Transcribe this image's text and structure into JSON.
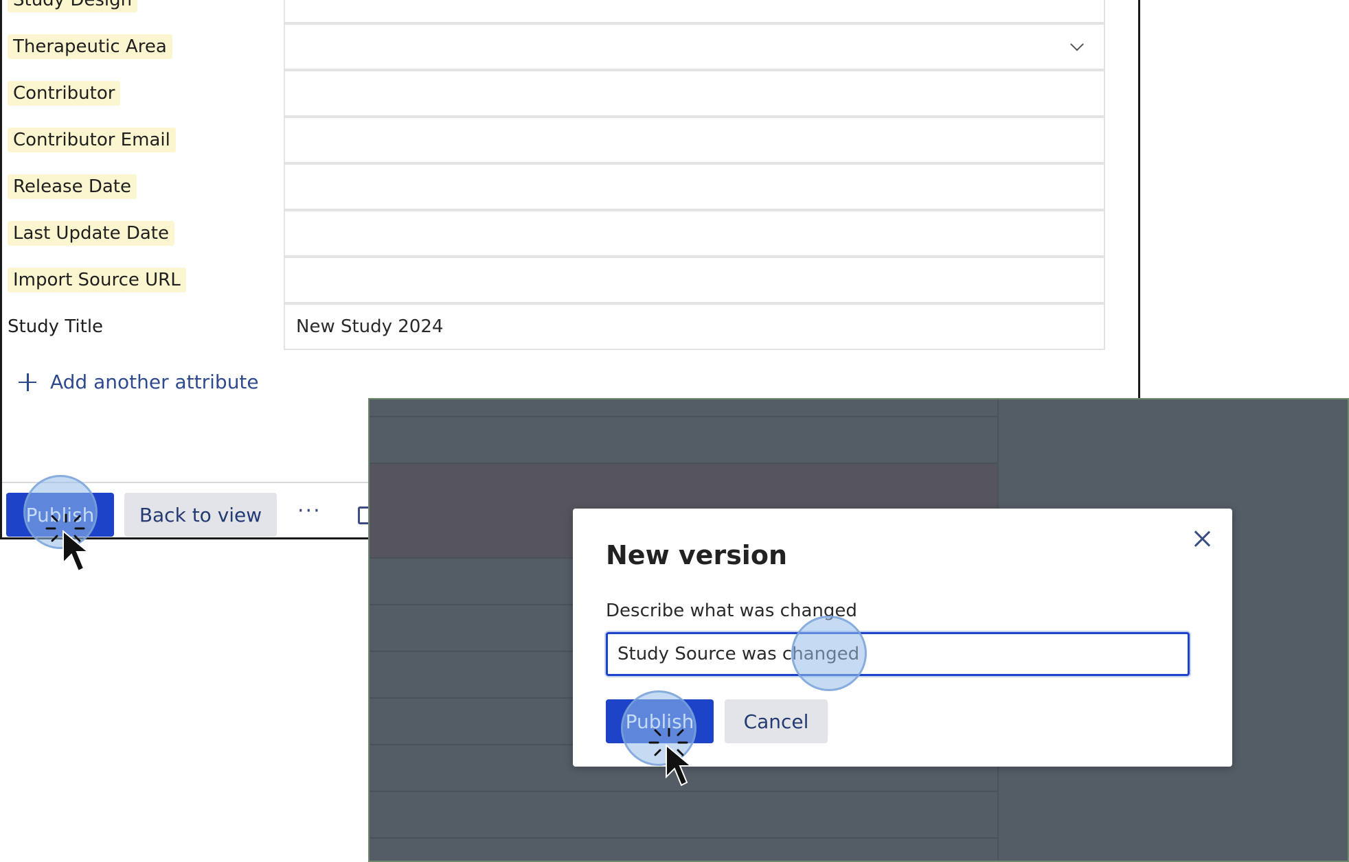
{
  "form": {
    "cut_off_label": "Study Design",
    "attributes": [
      {
        "label": "Therapeutic Area",
        "value": "",
        "dropdown": true,
        "highlighted": true
      },
      {
        "label": "Contributor",
        "value": "",
        "dropdown": false,
        "highlighted": true
      },
      {
        "label": "Contributor Email",
        "value": "",
        "dropdown": false,
        "highlighted": true
      },
      {
        "label": "Release Date",
        "value": "",
        "dropdown": false,
        "highlighted": true
      },
      {
        "label": "Last Update Date",
        "value": "",
        "dropdown": false,
        "highlighted": true
      },
      {
        "label": "Import Source URL",
        "value": "",
        "dropdown": false,
        "highlighted": true
      },
      {
        "label": "Study Title",
        "value": "New Study 2024",
        "dropdown": false,
        "highlighted": false
      }
    ],
    "add_attribute_label": "Add another attribute"
  },
  "footer": {
    "publish_label": "Publish",
    "back_label": "Back to view",
    "more_label": "···"
  },
  "modal": {
    "title": "New version",
    "field_label": "Describe what was changed",
    "field_value": "Study Source was changed",
    "publish_label": "Publish",
    "cancel_label": "Cancel"
  },
  "colors": {
    "primary": "#1c43c8",
    "label_highlight": "#fbf6cf",
    "overlay": "#545c66",
    "link": "#2e4a8f"
  }
}
